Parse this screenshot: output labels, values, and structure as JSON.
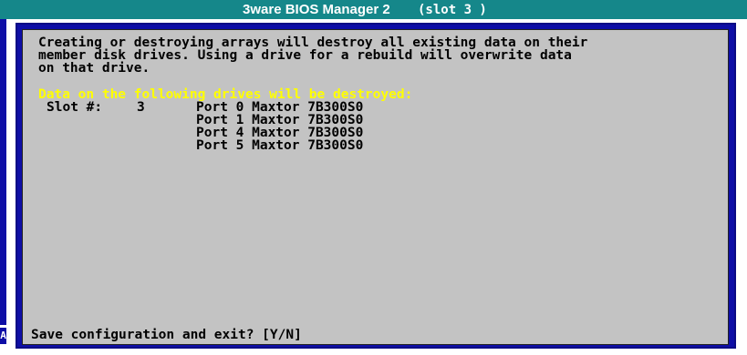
{
  "title_bar": {
    "app_name": "3ware BIOS Manager 2",
    "slot_label": "(slot 3 )"
  },
  "left_strip": {
    "marker_letter": "A"
  },
  "dialog": {
    "message_lines": [
      "Creating or destroying arrays will destroy all existing data on their",
      "member disk drives. Using a drive for a rebuild will overwrite data",
      "on that drive."
    ],
    "warning": "Data on the following drives will be destroyed:",
    "slot_label": "Slot #:",
    "slot_number": "3",
    "drives": [
      "Port 0 Maxtor 7B300S0",
      "Port 1 Maxtor 7B300S0",
      "Port 4 Maxtor 7B300S0",
      "Port 5 Maxtor 7B300S0"
    ],
    "prompt": "Save configuration and exit? [Y/N]"
  },
  "colors": {
    "title_bar": "#15878a",
    "frame_blue": "#0e0ea6",
    "panel_gray": "#c3c3c3",
    "warning_yellow": "#ffff00",
    "text": "#000000"
  }
}
